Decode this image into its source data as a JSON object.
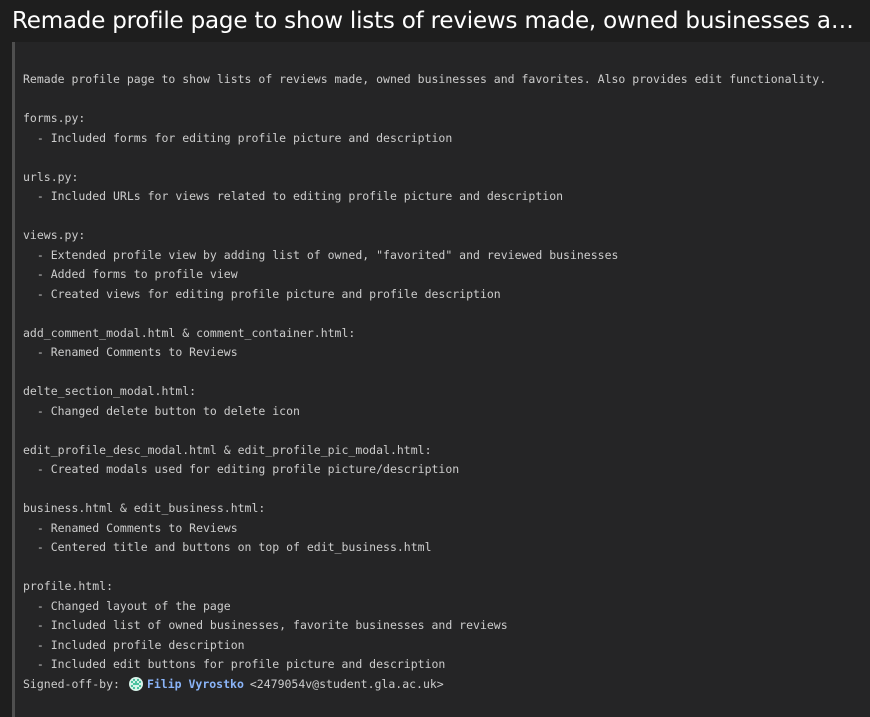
{
  "title": "Remade profile page to show lists of reviews made, owned businesses and…",
  "body": "Remade profile page to show lists of reviews made, owned businesses and favorites. Also provides edit functionality.\n\nforms.py:\n  - Included forms for editing profile picture and description\n\nurls.py:\n  - Included URLs for views related to editing profile picture and description\n\nviews.py:\n  - Extended profile view by adding list of owned, \"favorited\" and reviewed businesses\n  - Added forms to profile view\n  - Created views for editing profile picture and profile description\n\nadd_comment_modal.html & comment_container.html:\n  - Renamed Comments to Reviews\n\ndelte_section_modal.html:\n  - Changed delete button to delete icon\n\nedit_profile_desc_modal.html & edit_profile_pic_modal.html:\n  - Created modals used for editing profile picture/description\n\nbusiness.html & edit_business.html:\n  - Renamed Comments to Reviews\n  - Centered title and buttons on top of edit_business.html\n\nprofile.html:\n  - Changed layout of the page\n  - Included list of owned businesses, favorite businesses and reviews\n  - Included profile description\n  - Included edit buttons for profile picture and description",
  "signoff": {
    "label": "Signed-off-by:",
    "author": "Filip Vyrostko",
    "email": "<2479054v@student.gla.ac.uk>"
  },
  "colors": {
    "background": "#1e1e1e",
    "panel": "#252526",
    "link": "#8ab4f8",
    "avatar": "#4cc2a0"
  },
  "icons": {
    "avatar": "identicon-avatar-icon"
  }
}
